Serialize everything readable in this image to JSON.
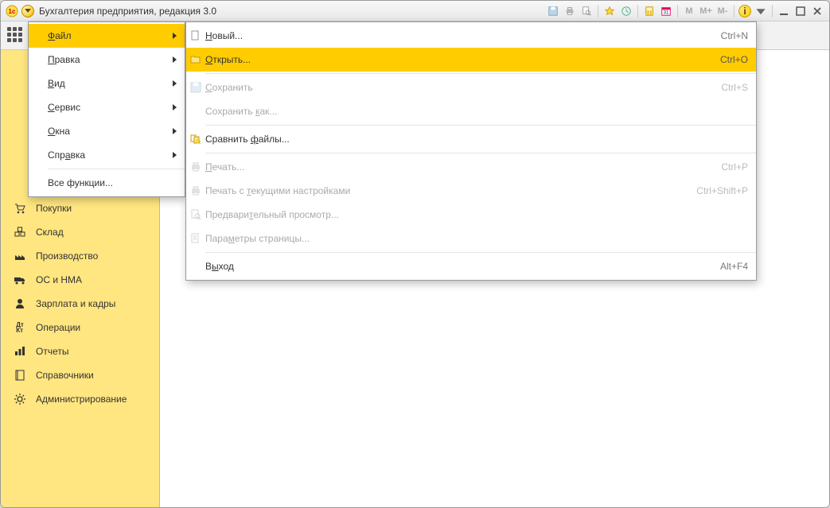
{
  "title": "Бухгалтерия предприятия, редакция 3.0",
  "toolbar_markers": {
    "m": "M",
    "mp": "M+",
    "mm": "M-"
  },
  "main_menu": {
    "file": "Файл",
    "edit": "Правка",
    "view": "Вид",
    "service": "Сервис",
    "windows": "Окна",
    "help": "Справка",
    "all_funcs": "Все функции..."
  },
  "file_menu": {
    "new": "Новый...",
    "open": "Открыть...",
    "save": "Сохранить",
    "save_as": "Сохранить как...",
    "compare": "Сравнить файлы...",
    "print": "Печать...",
    "print_current": "Печать с текущими настройками",
    "preview": "Предварительный просмотр...",
    "page_setup": "Параметры страницы...",
    "exit": "Выход",
    "sc_new": "Ctrl+N",
    "sc_open": "Ctrl+O",
    "sc_save": "Ctrl+S",
    "sc_print": "Ctrl+P",
    "sc_print_current": "Ctrl+Shift+P",
    "sc_exit": "Alt+F4"
  },
  "sidebar": {
    "items": [
      {
        "label": "Покупки"
      },
      {
        "label": "Склад"
      },
      {
        "label": "Производство"
      },
      {
        "label": "ОС и НМА"
      },
      {
        "label": "Зарплата и кадры"
      },
      {
        "label": "Операции"
      },
      {
        "label": "Отчеты"
      },
      {
        "label": "Справочники"
      },
      {
        "label": "Администрирование"
      }
    ]
  }
}
